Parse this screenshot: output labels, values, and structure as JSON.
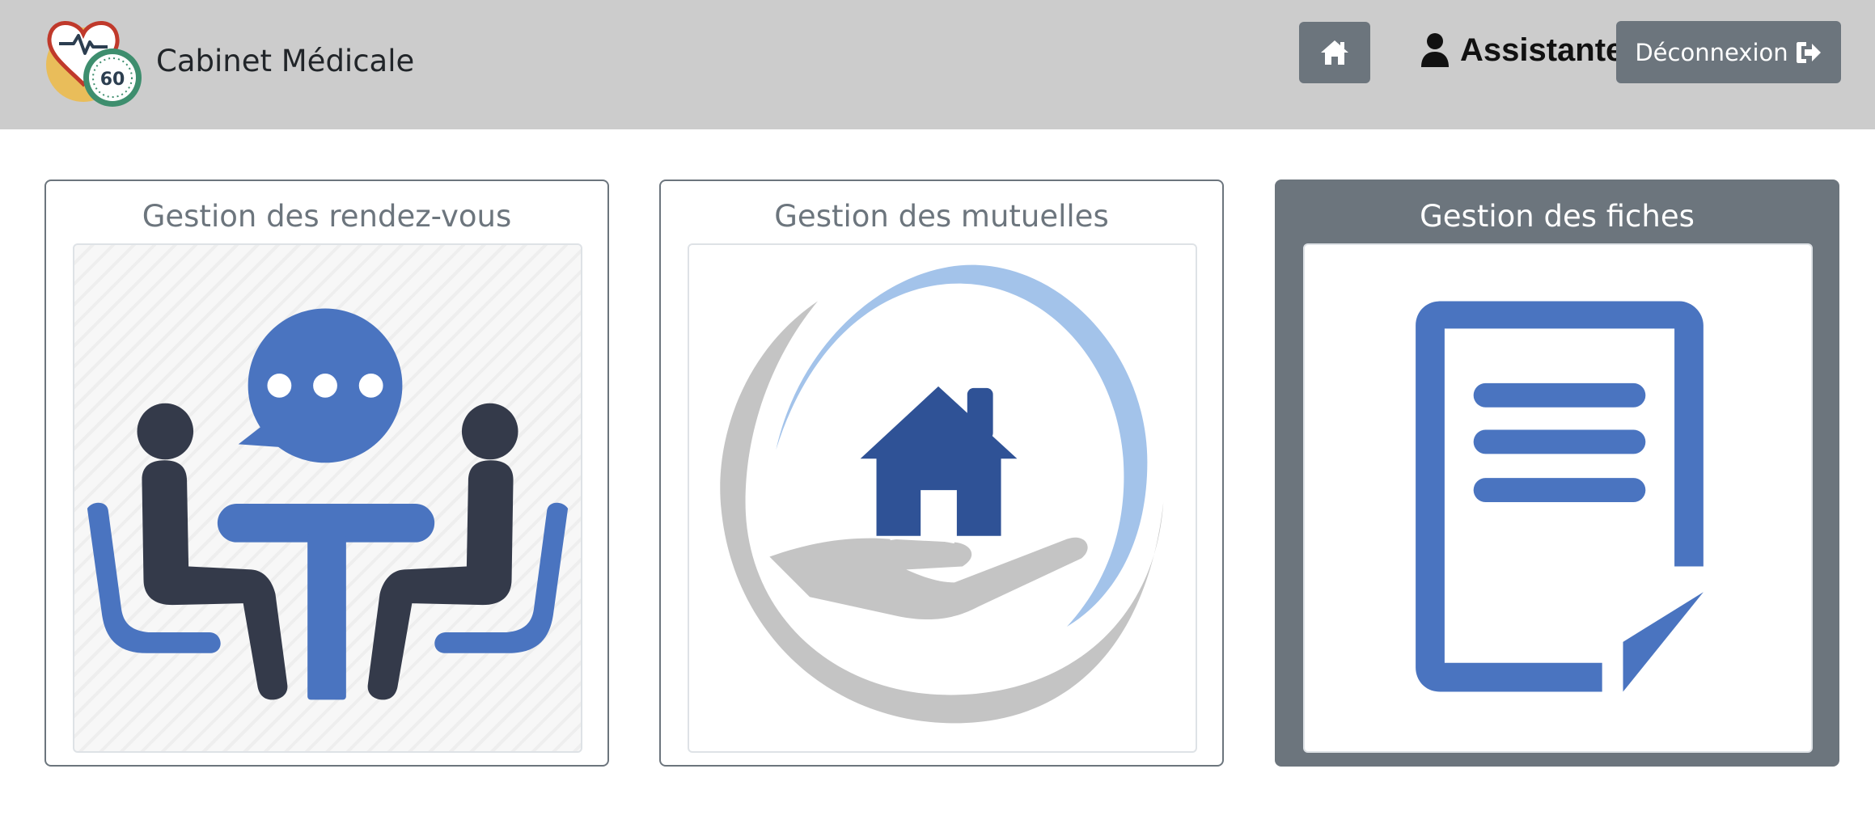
{
  "navbar": {
    "brand_name": "Cabinet Médicale",
    "logo_badge": "60",
    "home_icon": "home-icon",
    "user_icon": "user-icon",
    "user_role": "Assistante",
    "logout_label": "Déconnexion",
    "logout_icon": "sign-out-icon"
  },
  "cards": [
    {
      "title": "Gestion des rendez-vous",
      "image": "meeting-illustration",
      "active": false
    },
    {
      "title": "Gestion des mutuelles",
      "image": "insurance-house-hand-illustration",
      "active": false
    },
    {
      "title": "Gestion des fiches",
      "image": "document-illustration",
      "active": true
    }
  ],
  "colors": {
    "navbar_bg": "#cccccc",
    "secondary": "#6c757d",
    "illustration_blue": "#4a74c0",
    "illustration_dark": "#343a4a",
    "house_blue": "#2f5296",
    "arc_light_blue": "#a3c3ea",
    "arc_gray": "#c4c4c4"
  }
}
